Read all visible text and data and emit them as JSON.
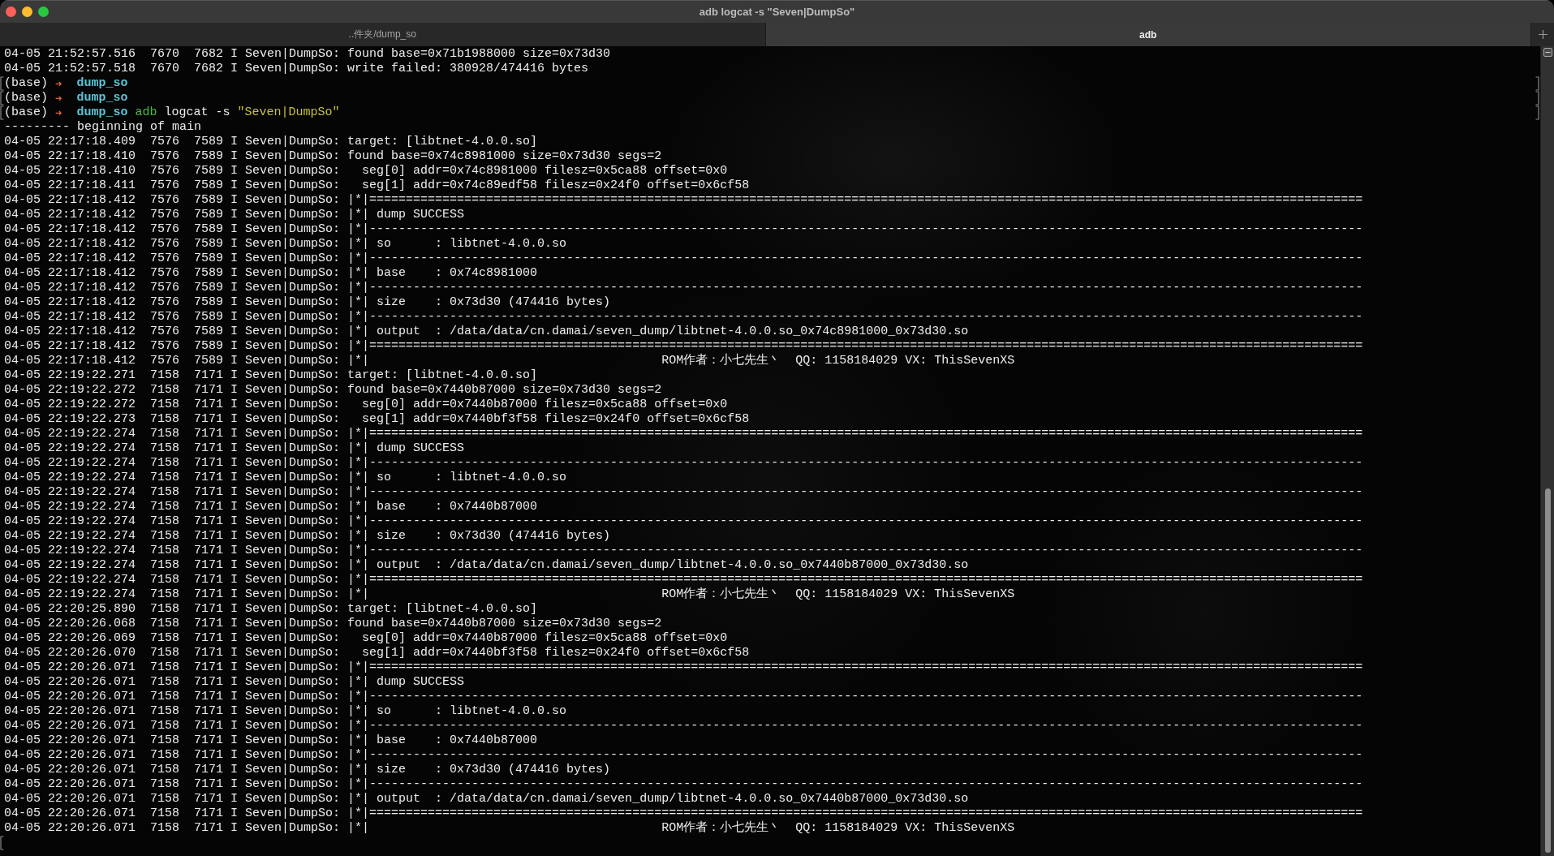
{
  "window": {
    "title": "adb logcat -s \"Seven|DumpSo\""
  },
  "tabs": [
    {
      "label": "..件夹/dump_so",
      "selected": false
    },
    {
      "label": "adb",
      "selected": true
    }
  ],
  "terminal": {
    "lines": [
      {
        "kind": "log",
        "text": "04-05 21:52:57.516  7670  7682 I Seven|DumpSo: found base=0x71b1988000 size=0x73d30"
      },
      {
        "kind": "log",
        "text": "04-05 21:52:57.518  7670  7682 I Seven|DumpSo: write failed: 380928/474416 bytes"
      },
      {
        "kind": "prompt",
        "segments": [
          {
            "kind": "env",
            "text": "(base)"
          },
          {
            "kind": "arrow",
            "text": "➜"
          },
          {
            "kind": "dir",
            "text": "dump_so"
          }
        ]
      },
      {
        "kind": "prompt",
        "segments": [
          {
            "kind": "env",
            "text": "(base)"
          },
          {
            "kind": "arrow",
            "text": "➜"
          },
          {
            "kind": "dir",
            "text": "dump_so"
          }
        ]
      },
      {
        "kind": "prompt",
        "segments": [
          {
            "kind": "env",
            "text": "(base)"
          },
          {
            "kind": "arrow",
            "text": "➜"
          },
          {
            "kind": "dir",
            "text": "dump_so"
          },
          {
            "kind": "command",
            "text": "adb"
          },
          {
            "kind": "args",
            "text": "logcat -s"
          },
          {
            "kind": "string",
            "text": "\"Seven|DumpSo\""
          }
        ]
      },
      {
        "kind": "plain",
        "text": "--------- beginning of main"
      },
      {
        "kind": "log",
        "text": "04-05 22:17:18.409  7576  7589 I Seven|DumpSo: target: [libtnet-4.0.0.so]"
      },
      {
        "kind": "log",
        "text": "04-05 22:17:18.410  7576  7589 I Seven|DumpSo: found base=0x74c8981000 size=0x73d30 segs=2"
      },
      {
        "kind": "log",
        "text": "04-05 22:17:18.410  7576  7589 I Seven|DumpSo:   seg[0] addr=0x74c8981000 filesz=0x5ca88 offset=0x0"
      },
      {
        "kind": "log",
        "text": "04-05 22:17:18.411  7576  7589 I Seven|DumpSo:   seg[1] addr=0x74c89edf58 filesz=0x24f0 offset=0x6cf58"
      },
      {
        "kind": "log",
        "text": "04-05 22:17:18.412  7576  7589 I Seven|DumpSo: |*|========================================================================================================================================"
      },
      {
        "kind": "log",
        "text": "04-05 22:17:18.412  7576  7589 I Seven|DumpSo: |*| dump SUCCESS"
      },
      {
        "kind": "log",
        "text": "04-05 22:17:18.412  7576  7589 I Seven|DumpSo: |*|----------------------------------------------------------------------------------------------------------------------------------------"
      },
      {
        "kind": "log",
        "text": "04-05 22:17:18.412  7576  7589 I Seven|DumpSo: |*| so      : libtnet-4.0.0.so"
      },
      {
        "kind": "log",
        "text": "04-05 22:17:18.412  7576  7589 I Seven|DumpSo: |*|----------------------------------------------------------------------------------------------------------------------------------------"
      },
      {
        "kind": "log",
        "text": "04-05 22:17:18.412  7576  7589 I Seven|DumpSo: |*| base    : 0x74c8981000"
      },
      {
        "kind": "log",
        "text": "04-05 22:17:18.412  7576  7589 I Seven|DumpSo: |*|----------------------------------------------------------------------------------------------------------------------------------------"
      },
      {
        "kind": "log",
        "text": "04-05 22:17:18.412  7576  7589 I Seven|DumpSo: |*| size    : 0x73d30 (474416 bytes)"
      },
      {
        "kind": "log",
        "text": "04-05 22:17:18.412  7576  7589 I Seven|DumpSo: |*|----------------------------------------------------------------------------------------------------------------------------------------"
      },
      {
        "kind": "log",
        "text": "04-05 22:17:18.412  7576  7589 I Seven|DumpSo: |*| output  : /data/data/cn.damai/seven_dump/libtnet-4.0.0.so_0x74c8981000_0x73d30.so"
      },
      {
        "kind": "log",
        "text": "04-05 22:17:18.412  7576  7589 I Seven|DumpSo: |*|========================================================================================================================================"
      },
      {
        "kind": "log",
        "text": "04-05 22:17:18.412  7576  7589 I Seven|DumpSo: |*|                                        ROM作者：小七先生丶  QQ: 1158184029 VX: ThisSevenXS"
      },
      {
        "kind": "log",
        "text": "04-05 22:19:22.271  7158  7171 I Seven|DumpSo: target: [libtnet-4.0.0.so]"
      },
      {
        "kind": "log",
        "text": "04-05 22:19:22.272  7158  7171 I Seven|DumpSo: found base=0x7440b87000 size=0x73d30 segs=2"
      },
      {
        "kind": "log",
        "text": "04-05 22:19:22.272  7158  7171 I Seven|DumpSo:   seg[0] addr=0x7440b87000 filesz=0x5ca88 offset=0x0"
      },
      {
        "kind": "log",
        "text": "04-05 22:19:22.273  7158  7171 I Seven|DumpSo:   seg[1] addr=0x7440bf3f58 filesz=0x24f0 offset=0x6cf58"
      },
      {
        "kind": "log",
        "text": "04-05 22:19:22.274  7158  7171 I Seven|DumpSo: |*|========================================================================================================================================"
      },
      {
        "kind": "log",
        "text": "04-05 22:19:22.274  7158  7171 I Seven|DumpSo: |*| dump SUCCESS"
      },
      {
        "kind": "log",
        "text": "04-05 22:19:22.274  7158  7171 I Seven|DumpSo: |*|----------------------------------------------------------------------------------------------------------------------------------------"
      },
      {
        "kind": "log",
        "text": "04-05 22:19:22.274  7158  7171 I Seven|DumpSo: |*| so      : libtnet-4.0.0.so"
      },
      {
        "kind": "log",
        "text": "04-05 22:19:22.274  7158  7171 I Seven|DumpSo: |*|----------------------------------------------------------------------------------------------------------------------------------------"
      },
      {
        "kind": "log",
        "text": "04-05 22:19:22.274  7158  7171 I Seven|DumpSo: |*| base    : 0x7440b87000"
      },
      {
        "kind": "log",
        "text": "04-05 22:19:22.274  7158  7171 I Seven|DumpSo: |*|----------------------------------------------------------------------------------------------------------------------------------------"
      },
      {
        "kind": "log",
        "text": "04-05 22:19:22.274  7158  7171 I Seven|DumpSo: |*| size    : 0x73d30 (474416 bytes)"
      },
      {
        "kind": "log",
        "text": "04-05 22:19:22.274  7158  7171 I Seven|DumpSo: |*|----------------------------------------------------------------------------------------------------------------------------------------"
      },
      {
        "kind": "log",
        "text": "04-05 22:19:22.274  7158  7171 I Seven|DumpSo: |*| output  : /data/data/cn.damai/seven_dump/libtnet-4.0.0.so_0x7440b87000_0x73d30.so"
      },
      {
        "kind": "log",
        "text": "04-05 22:19:22.274  7158  7171 I Seven|DumpSo: |*|========================================================================================================================================"
      },
      {
        "kind": "log",
        "text": "04-05 22:19:22.274  7158  7171 I Seven|DumpSo: |*|                                        ROM作者：小七先生丶  QQ: 1158184029 VX: ThisSevenXS"
      },
      {
        "kind": "log",
        "text": "04-05 22:20:25.890  7158  7171 I Seven|DumpSo: target: [libtnet-4.0.0.so]"
      },
      {
        "kind": "log",
        "text": "04-05 22:20:26.068  7158  7171 I Seven|DumpSo: found base=0x7440b87000 size=0x73d30 segs=2"
      },
      {
        "kind": "log",
        "text": "04-05 22:20:26.069  7158  7171 I Seven|DumpSo:   seg[0] addr=0x7440b87000 filesz=0x5ca88 offset=0x0"
      },
      {
        "kind": "log",
        "text": "04-05 22:20:26.070  7158  7171 I Seven|DumpSo:   seg[1] addr=0x7440bf3f58 filesz=0x24f0 offset=0x6cf58"
      },
      {
        "kind": "log",
        "text": "04-05 22:20:26.071  7158  7171 I Seven|DumpSo: |*|========================================================================================================================================"
      },
      {
        "kind": "log",
        "text": "04-05 22:20:26.071  7158  7171 I Seven|DumpSo: |*| dump SUCCESS"
      },
      {
        "kind": "log",
        "text": "04-05 22:20:26.071  7158  7171 I Seven|DumpSo: |*|----------------------------------------------------------------------------------------------------------------------------------------"
      },
      {
        "kind": "log",
        "text": "04-05 22:20:26.071  7158  7171 I Seven|DumpSo: |*| so      : libtnet-4.0.0.so"
      },
      {
        "kind": "log",
        "text": "04-05 22:20:26.071  7158  7171 I Seven|DumpSo: |*|----------------------------------------------------------------------------------------------------------------------------------------"
      },
      {
        "kind": "log",
        "text": "04-05 22:20:26.071  7158  7171 I Seven|DumpSo: |*| base    : 0x7440b87000"
      },
      {
        "kind": "log",
        "text": "04-05 22:20:26.071  7158  7171 I Seven|DumpSo: |*|----------------------------------------------------------------------------------------------------------------------------------------"
      },
      {
        "kind": "log",
        "text": "04-05 22:20:26.071  7158  7171 I Seven|DumpSo: |*| size    : 0x73d30 (474416 bytes)"
      },
      {
        "kind": "log",
        "text": "04-05 22:20:26.071  7158  7171 I Seven|DumpSo: |*|----------------------------------------------------------------------------------------------------------------------------------------"
      },
      {
        "kind": "log",
        "text": "04-05 22:20:26.071  7158  7171 I Seven|DumpSo: |*| output  : /data/data/cn.damai/seven_dump/libtnet-4.0.0.so_0x7440b87000_0x73d30.so"
      },
      {
        "kind": "log",
        "text": "04-05 22:20:26.071  7158  7171 I Seven|DumpSo: |*|========================================================================================================================================"
      },
      {
        "kind": "log",
        "text": "04-05 22:20:26.071  7158  7171 I Seven|DumpSo: |*|                                        ROM作者：小七先生丶  QQ: 1158184029 VX: ThisSevenXS"
      },
      {
        "kind": "cursor"
      }
    ]
  }
}
